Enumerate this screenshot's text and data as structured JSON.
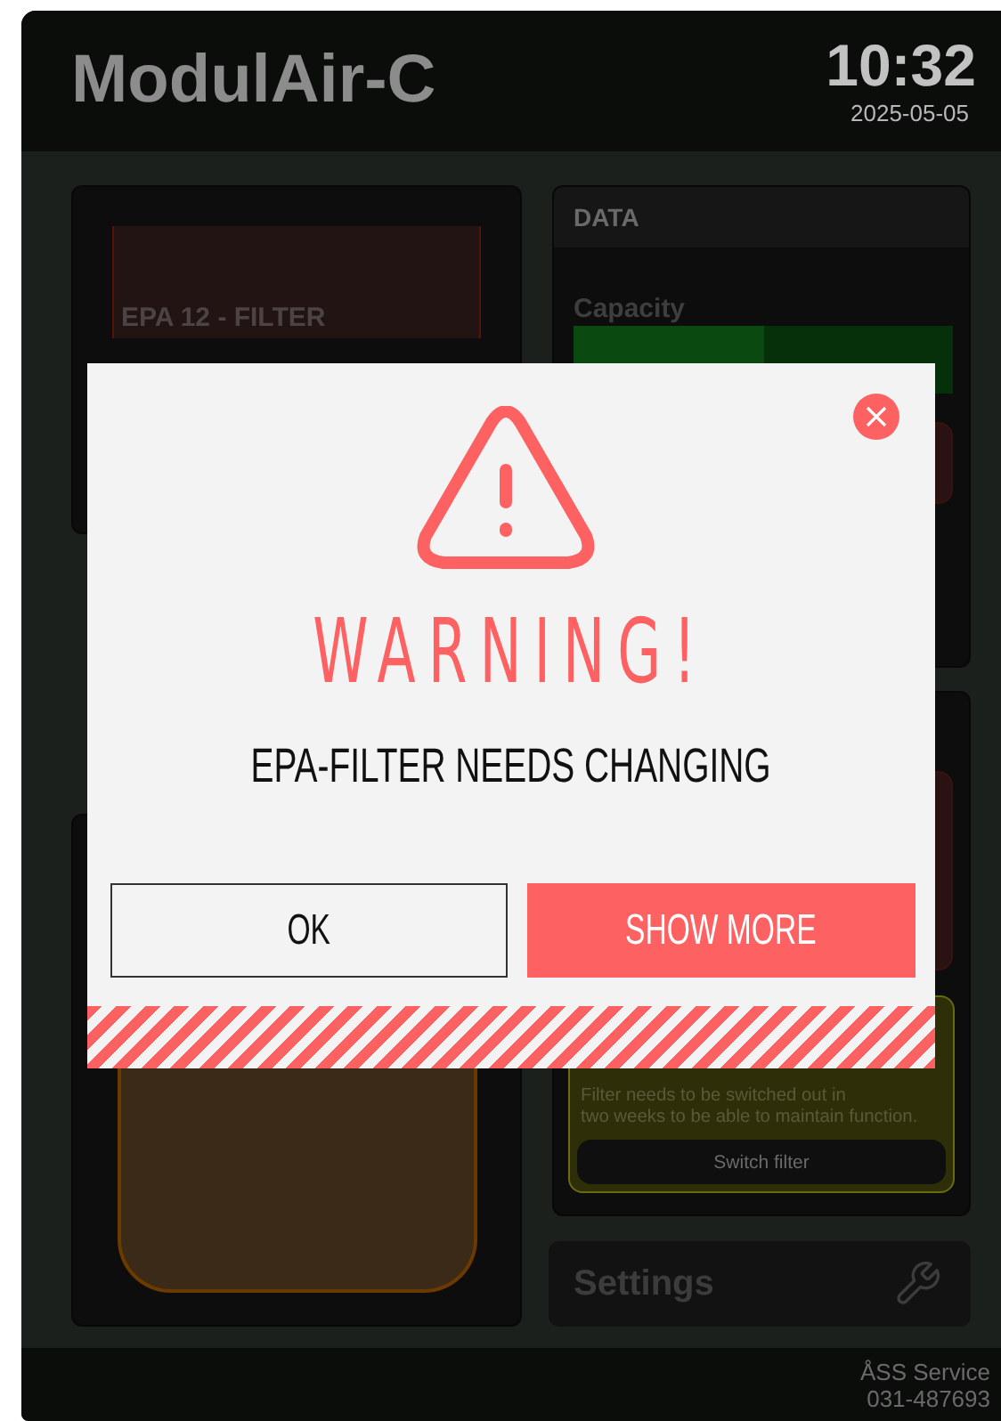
{
  "header": {
    "title": "ModulAir-C",
    "time": "10:32",
    "date": "2025-05-05"
  },
  "filter_card": {
    "label": "EPA 12 - FILTER"
  },
  "data_card": {
    "title": "DATA",
    "capacity": {
      "label": "Capacity",
      "level": 0.5
    }
  },
  "filter_notice": {
    "message": "Filter needs to be switched out in\ntwo weeks to be able to maintain function.",
    "button": "Switch filter"
  },
  "settings": {
    "label": "Settings"
  },
  "footer": {
    "company": "ÅSS Service",
    "phone": "031-487693"
  },
  "dialog": {
    "title": "WARNING!",
    "message": "EPA-FILTER NEEDS CHANGING",
    "buttons": [
      {
        "label": "OK",
        "kind": "secondary"
      },
      {
        "label": "SHOW MORE",
        "kind": "primary"
      }
    ]
  }
}
